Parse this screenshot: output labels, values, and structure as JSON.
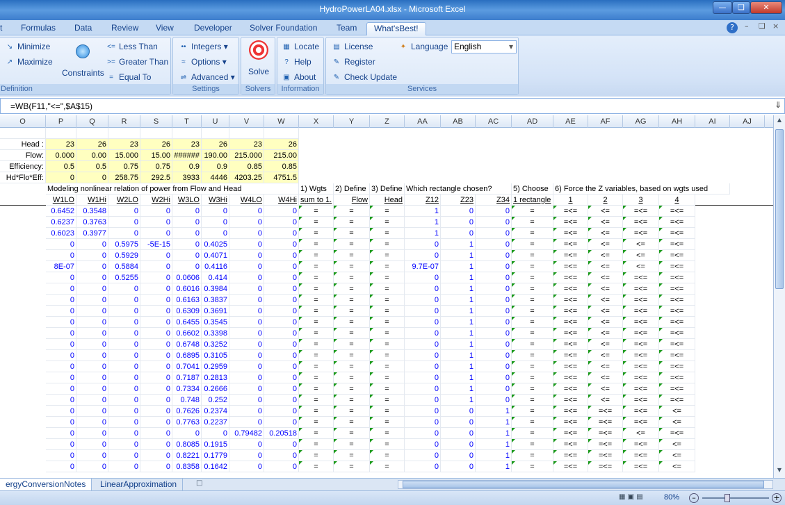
{
  "window": {
    "title": "HydroPowerLA04.xlsx - Microsoft Excel"
  },
  "tabs": [
    "t",
    "Formulas",
    "Data",
    "Review",
    "View",
    "Developer",
    "Solver Foundation",
    "Team",
    "What'sBest!"
  ],
  "ribbon": {
    "definition": {
      "label": "Definition",
      "minimize": "Minimize",
      "maximize": "Maximize",
      "constraints": "Constraints",
      "less_than": "Less Than",
      "greater_than": "Greater Than",
      "equal_to": "Equal To"
    },
    "settings": {
      "label": "Settings",
      "integers": "Integers",
      "options": "Options",
      "advanced": "Advanced"
    },
    "solvers": {
      "label": "Solvers",
      "solve": "Solve"
    },
    "information": {
      "label": "Information",
      "locate": "Locate",
      "help": "Help",
      "about": "About"
    },
    "services": {
      "label": "Services",
      "license": "License",
      "register": "Register",
      "check_update": "Check Update",
      "language_label": "Language",
      "language_value": "English"
    }
  },
  "formula": "=WB(F11,\"<=\",$A$15)",
  "columns": [
    "O",
    "P",
    "Q",
    "R",
    "S",
    "T",
    "U",
    "V",
    "W",
    "X",
    "Y",
    "Z",
    "AA",
    "AB",
    "AC",
    "AD",
    "AE",
    "AF",
    "AG",
    "AH",
    "AI",
    "AJ"
  ],
  "top_rows": [
    {
      "label": "",
      "vals": [
        "",
        "",
        "",
        "",
        "",
        "",
        "",
        ""
      ]
    },
    {
      "label": "Head :",
      "vals": [
        "23",
        "26",
        "23",
        "26",
        "23",
        "26",
        "23",
        "26"
      ]
    },
    {
      "label": "Flow:",
      "vals": [
        "0.000",
        "0.00",
        "15.000",
        "15.00",
        "######",
        "190.00",
        "215.000",
        "215.00"
      ]
    },
    {
      "label": "Efficiency:",
      "vals": [
        "0.5",
        "0.5",
        "0.75",
        "0.75",
        "0.9",
        "0.9",
        "0.85",
        "0.85"
      ]
    },
    {
      "label": "Hd*Flo*Eff:",
      "vals": [
        "0",
        "0",
        "258.75",
        "292.5",
        "3933",
        "4446",
        "4203.25",
        "4751.5"
      ]
    }
  ],
  "section_titles": {
    "modeling": "Modeling nonlinear relation of power from Flow and Head",
    "s1": "1) Wgts",
    "s2": "2) Define",
    "s3": "3) Define",
    "which": "Which rectangle chosen?",
    "s5": "5) Choose",
    "s6": "6) Force the Z variables, based on wgts used"
  },
  "headers": [
    "W1LO",
    "W1Hi",
    "W2LO",
    "W2Hi",
    "W3LO",
    "W3Hi",
    "W4LO",
    "W4Hi",
    "sum to 1.",
    "Flow",
    "Head",
    "Z12",
    "Z23",
    "Z34",
    "1 rectangle",
    "1",
    "2",
    "3",
    "4"
  ],
  "data_rows": [
    [
      "0.6452",
      "0.3548",
      "0",
      "0",
      "0",
      "0",
      "0",
      "0",
      "=",
      "=",
      "=",
      "1",
      "0",
      "0",
      "=",
      "=<=",
      "<=",
      "=<=",
      "=<="
    ],
    [
      "0.6237",
      "0.3763",
      "0",
      "0",
      "0",
      "0",
      "0",
      "0",
      "=",
      "=",
      "=",
      "1",
      "0",
      "0",
      "=",
      "=<=",
      "<=",
      "=<=",
      "=<="
    ],
    [
      "0.6023",
      "0.3977",
      "0",
      "0",
      "0",
      "0",
      "0",
      "0",
      "=",
      "=",
      "=",
      "1",
      "0",
      "0",
      "=",
      "=<=",
      "<=",
      "=<=",
      "=<="
    ],
    [
      "0",
      "0",
      "0.5975",
      "-5E-15",
      "0",
      "0.4025",
      "0",
      "0",
      "=",
      "=",
      "=",
      "0",
      "1",
      "0",
      "=",
      "=<=",
      "<=",
      "<=",
      "=<="
    ],
    [
      "0",
      "0",
      "0.5929",
      "0",
      "0",
      "0.4071",
      "0",
      "0",
      "=",
      "=",
      "=",
      "0",
      "1",
      "0",
      "=",
      "=<=",
      "<=",
      "<=",
      "=<="
    ],
    [
      "8E-07",
      "0",
      "0.5884",
      "0",
      "0",
      "0.4116",
      "0",
      "0",
      "=",
      "=",
      "=",
      "9.7E-07",
      "1",
      "0",
      "=",
      "=<=",
      "<=",
      "<=",
      "=<="
    ],
    [
      "0",
      "0",
      "0.5255",
      "0",
      "0.0606",
      "0.414",
      "0",
      "0",
      "=",
      "=",
      "=",
      "0",
      "1",
      "0",
      "=",
      "=<=",
      "<=",
      "=<=",
      "=<="
    ],
    [
      "0",
      "0",
      "0",
      "0",
      "0.6016",
      "0.3984",
      "0",
      "0",
      "=",
      "=",
      "=",
      "0",
      "1",
      "0",
      "=",
      "=<=",
      "<=",
      "=<=",
      "=<="
    ],
    [
      "0",
      "0",
      "0",
      "0",
      "0.6163",
      "0.3837",
      "0",
      "0",
      "=",
      "=",
      "=",
      "0",
      "1",
      "0",
      "=",
      "=<=",
      "<=",
      "=<=",
      "=<="
    ],
    [
      "0",
      "0",
      "0",
      "0",
      "0.6309",
      "0.3691",
      "0",
      "0",
      "=",
      "=",
      "=",
      "0",
      "1",
      "0",
      "=",
      "=<=",
      "<=",
      "=<=",
      "=<="
    ],
    [
      "0",
      "0",
      "0",
      "0",
      "0.6455",
      "0.3545",
      "0",
      "0",
      "=",
      "=",
      "=",
      "0",
      "1",
      "0",
      "=",
      "=<=",
      "<=",
      "=<=",
      "=<="
    ],
    [
      "0",
      "0",
      "0",
      "0",
      "0.6602",
      "0.3398",
      "0",
      "0",
      "=",
      "=",
      "=",
      "0",
      "1",
      "0",
      "=",
      "=<=",
      "<=",
      "=<=",
      "=<="
    ],
    [
      "0",
      "0",
      "0",
      "0",
      "0.6748",
      "0.3252",
      "0",
      "0",
      "=",
      "=",
      "=",
      "0",
      "1",
      "0",
      "=",
      "=<=",
      "<=",
      "=<=",
      "=<="
    ],
    [
      "0",
      "0",
      "0",
      "0",
      "0.6895",
      "0.3105",
      "0",
      "0",
      "=",
      "=",
      "=",
      "0",
      "1",
      "0",
      "=",
      "=<=",
      "<=",
      "=<=",
      "=<="
    ],
    [
      "0",
      "0",
      "0",
      "0",
      "0.7041",
      "0.2959",
      "0",
      "0",
      "=",
      "=",
      "=",
      "0",
      "1",
      "0",
      "=",
      "=<=",
      "<=",
      "=<=",
      "=<="
    ],
    [
      "0",
      "0",
      "0",
      "0",
      "0.7187",
      "0.2813",
      "0",
      "0",
      "=",
      "=",
      "=",
      "0",
      "1",
      "0",
      "=",
      "=<=",
      "<=",
      "=<=",
      "=<="
    ],
    [
      "0",
      "0",
      "0",
      "0",
      "0.7334",
      "0.2666",
      "0",
      "0",
      "=",
      "=",
      "=",
      "0",
      "1",
      "0",
      "=",
      "=<=",
      "<=",
      "=<=",
      "=<="
    ],
    [
      "0",
      "0",
      "0",
      "0",
      "0.748",
      "0.252",
      "0",
      "0",
      "=",
      "=",
      "=",
      "0",
      "1",
      "0",
      "=",
      "=<=",
      "<=",
      "=<=",
      "=<="
    ],
    [
      "0",
      "0",
      "0",
      "0",
      "0.7626",
      "0.2374",
      "0",
      "0",
      "=",
      "=",
      "=",
      "0",
      "0",
      "1",
      "=",
      "=<=",
      "=<=",
      "=<=",
      "<="
    ],
    [
      "0",
      "0",
      "0",
      "0",
      "0.7763",
      "0.2237",
      "0",
      "0",
      "=",
      "=",
      "=",
      "0",
      "0",
      "1",
      "=",
      "=<=",
      "=<=",
      "=<=",
      "<="
    ],
    [
      "0",
      "0",
      "0",
      "0",
      "0",
      "0",
      "0.79482",
      "0.20518",
      "=",
      "=",
      "=",
      "0",
      "0",
      "1",
      "=",
      "=<=",
      "=<=",
      "<=",
      "=<="
    ],
    [
      "0",
      "0",
      "0",
      "0",
      "0.8085",
      "0.1915",
      "0",
      "0",
      "=",
      "=",
      "=",
      "0",
      "0",
      "1",
      "=",
      "=<=",
      "=<=",
      "=<=",
      "<="
    ],
    [
      "0",
      "0",
      "0",
      "0",
      "0.8221",
      "0.1779",
      "0",
      "0",
      "=",
      "=",
      "=",
      "0",
      "0",
      "1",
      "=",
      "=<=",
      "=<=",
      "=<=",
      "<="
    ],
    [
      "0",
      "0",
      "0",
      "0",
      "0.8358",
      "0.1642",
      "0",
      "0",
      "=",
      "=",
      "=",
      "0",
      "0",
      "1",
      "=",
      "=<=",
      "=<=",
      "=<=",
      "<="
    ]
  ],
  "sheet_tabs": [
    "ergyConversionNotes",
    "LinearApproximation"
  ],
  "status": {
    "zoom": "80%"
  }
}
